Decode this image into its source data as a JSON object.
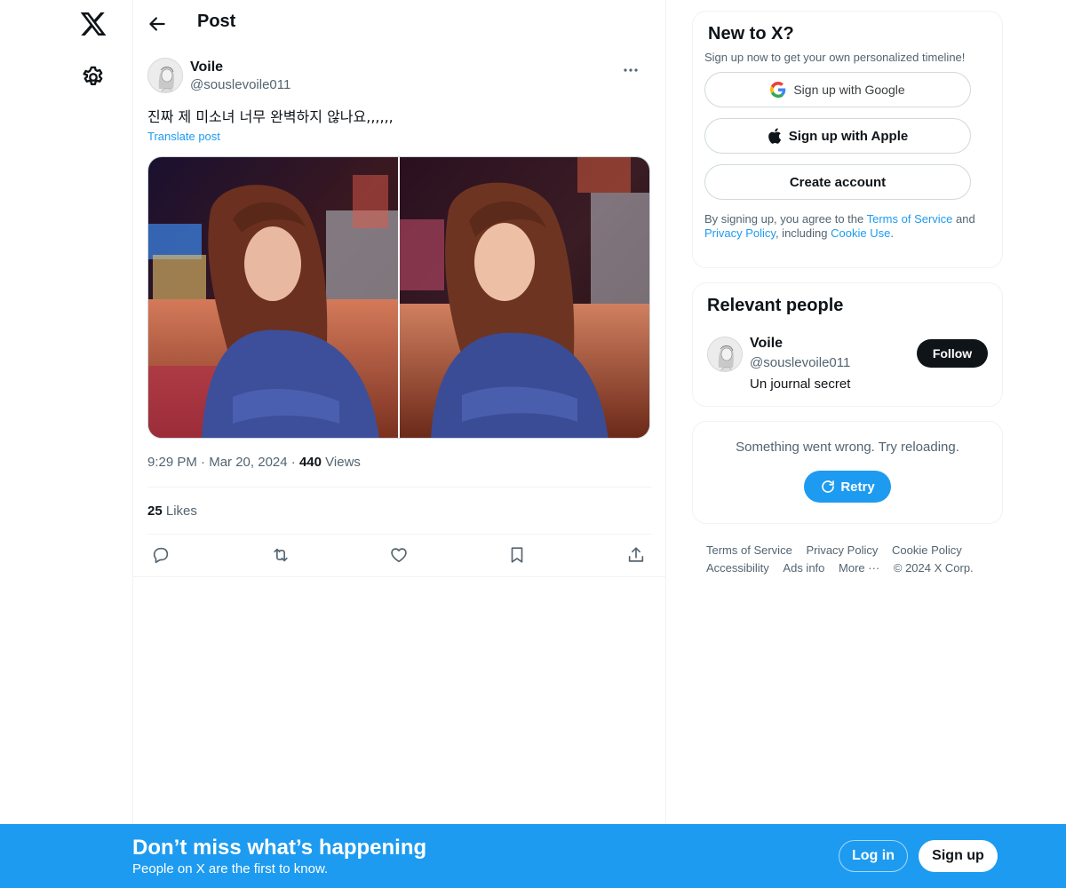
{
  "header": {
    "title": "Post"
  },
  "post": {
    "author_name": "Voile",
    "author_handle": "@souslevoile011",
    "text": "진짜 제 미소녀 너무 완벽하지 않나요,,,,,,",
    "translate_label": "Translate post",
    "time": "9:29 PM",
    "date": "Mar 20, 2024",
    "views_count": "440",
    "views_label": "Views",
    "likes_count": "25",
    "likes_label": "Likes"
  },
  "signup_card": {
    "title": "New to X?",
    "subtitle": "Sign up now to get your own personalized timeline!",
    "google_label": "Sign up with Google",
    "apple_label": "Sign up with Apple",
    "create_label": "Create account",
    "legal_prefix": "By signing up, you agree to the ",
    "terms_link": "Terms of Service",
    "legal_and": " and",
    "privacy_link": "Privacy Policy",
    "legal_including": ", including ",
    "cookie_link": "Cookie Use",
    "legal_end": "."
  },
  "relevant_people": {
    "title": "Relevant people",
    "name": "Voile",
    "handle": "@souslevoile011",
    "bio": "Un journal secret",
    "follow_label": "Follow"
  },
  "error_card": {
    "message": "Something went wrong. Try reloading.",
    "retry_label": "Retry"
  },
  "footer": {
    "links": [
      "Terms of Service",
      "Privacy Policy",
      "Cookie Policy",
      "Accessibility",
      "Ads info",
      "More ···",
      "© 2024 X Corp."
    ]
  },
  "bottom_bar": {
    "title": "Don’t miss what’s happening",
    "subtitle": "People on X are the first to know.",
    "login_label": "Log in",
    "signup_label": "Sign up"
  },
  "colors": {
    "accent": "#1d9bf0",
    "text": "#0f1419",
    "muted": "#536471"
  },
  "icons": [
    "x-logo-icon",
    "gear-icon",
    "back-arrow-icon",
    "more-icon",
    "reply-icon",
    "repost-icon",
    "like-icon",
    "bookmark-icon",
    "share-icon",
    "google-icon",
    "apple-icon",
    "refresh-icon"
  ]
}
